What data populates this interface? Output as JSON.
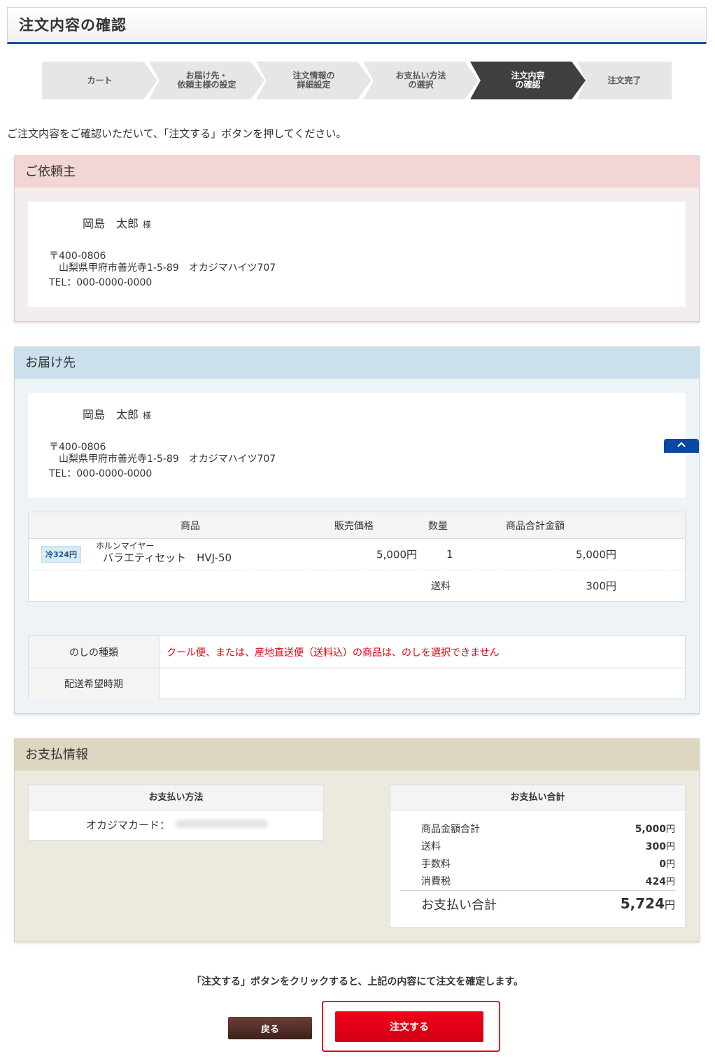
{
  "page": {
    "title": "注文内容の確認"
  },
  "steps": [
    {
      "label": "カート"
    },
    {
      "label": "お届け先・\n依頼主様の設定"
    },
    {
      "label": "注文情報の\n詳細設定"
    },
    {
      "label": "お支払い方法\nの選択"
    },
    {
      "label": "注文内容\nの確認"
    },
    {
      "label": "注文完了"
    }
  ],
  "intro": "ご注文内容をご確認いただいて、「注文する」ボタンを押してください。",
  "requester": {
    "heading": "ご依頼主",
    "name": "岡島　太郎",
    "honorific": "様",
    "postal": "〒400-0806",
    "address": "山梨県甲府市善光寺1-5-89　オカジマハイツ707",
    "tel": "TEL：000-0000-0000"
  },
  "delivery": {
    "heading": "お届け先",
    "name": "岡島　太郎",
    "honorific": "様",
    "postal": "〒400-0806",
    "address": "山梨県甲府市善光寺1-5-89　オカジマハイツ707",
    "tel": "TEL：000-0000-0000",
    "table": {
      "headers": {
        "product": "商品",
        "price": "販売価格",
        "qty": "数量",
        "subtotal": "商品合計金額"
      },
      "item": {
        "badge": "冷324円",
        "brand": "ホルンマイヤー",
        "name": "バラエティセット　HVJ-50",
        "price": "5,000円",
        "qty": "1",
        "subtotal": "5,000円"
      },
      "shipping_label": "送料",
      "shipping_value": "300円"
    },
    "noshi": {
      "type_label": "のしの種類",
      "type_value": "クール便、または、産地直送便（送料込）の商品は、のしを選択できません",
      "timing_label": "配送希望時期",
      "timing_value": ""
    }
  },
  "payment": {
    "heading": "お支払情報",
    "method_header": "お支払い方法",
    "method_value": "オカジマカード：",
    "total_header": "お支払い合計",
    "rows": [
      {
        "label": "商品金額合計",
        "value": "5,000",
        "unit": "円"
      },
      {
        "label": "送料",
        "value": "300",
        "unit": "円"
      },
      {
        "label": "手数料",
        "value": "0",
        "unit": "円"
      },
      {
        "label": "消費税",
        "value": "424",
        "unit": "円"
      }
    ],
    "grand_label": "お支払い合計",
    "grand_value": "5,724",
    "grand_unit": "円"
  },
  "confirm_note": "「注文する」ボタンをクリックすると、上記の内容にて注文を確定します。",
  "buttons": {
    "back": "戻る",
    "order": "注文する"
  },
  "colors": {
    "accent": "#1b4fa2",
    "order_red": "#e60012",
    "back_brown": "#4a2a22"
  }
}
